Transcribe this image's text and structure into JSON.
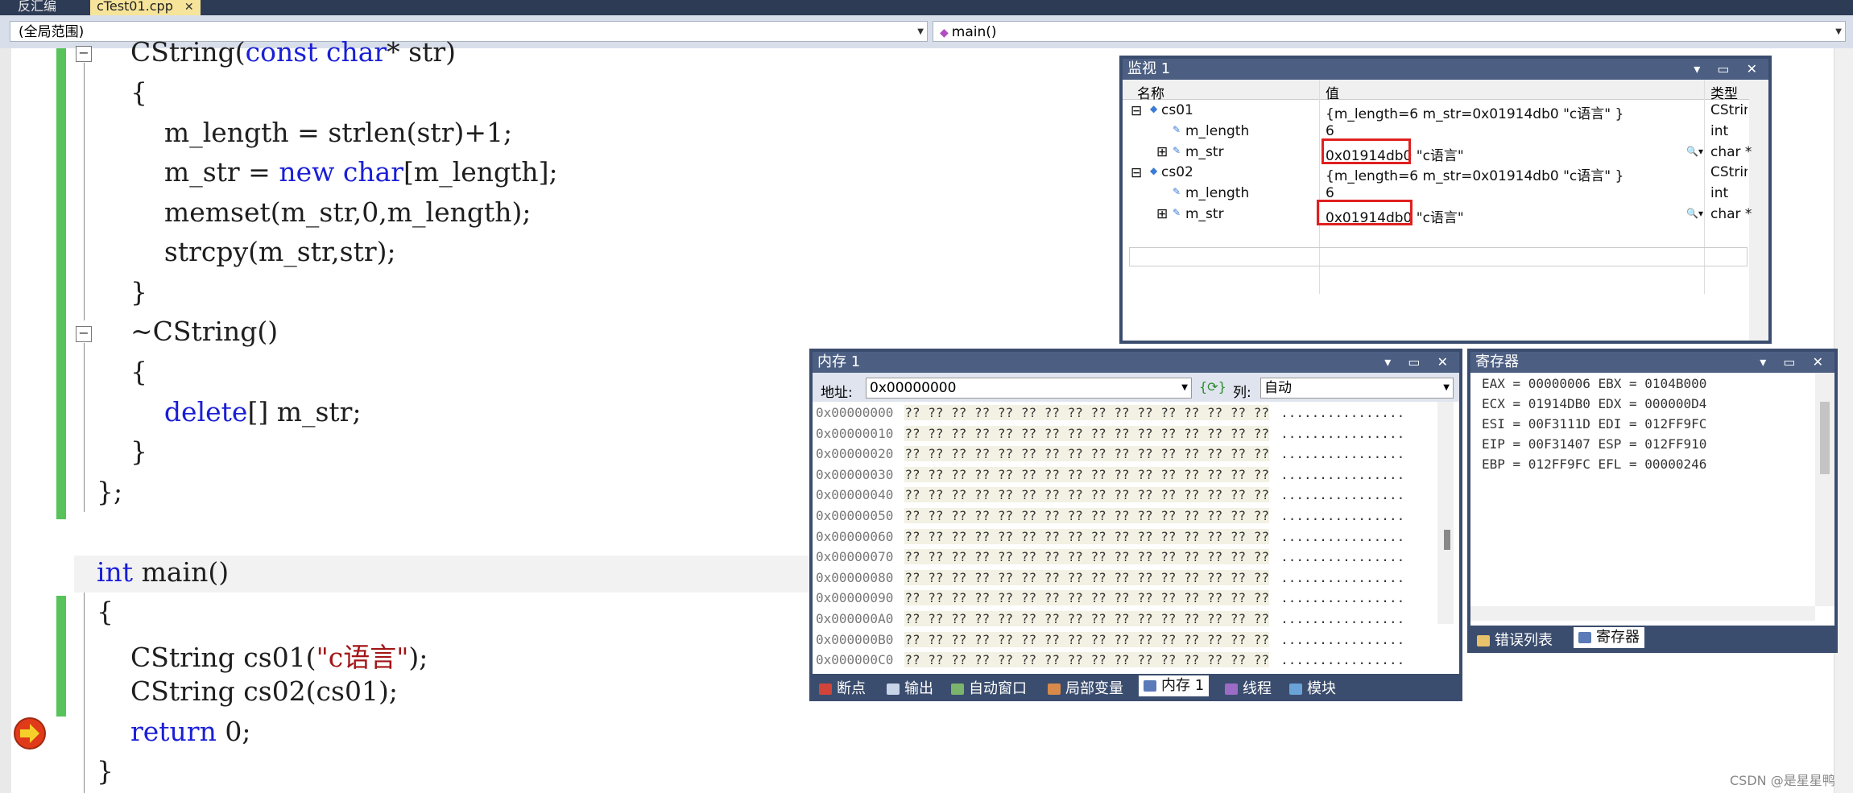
{
  "tabs": [
    {
      "label": "反汇编"
    },
    {
      "label": "cTest01.cpp",
      "close": "✕"
    }
  ],
  "nav": {
    "scope": "(全局范围)",
    "member": "main()"
  },
  "code": {
    "l1a": "    CString(",
    "l1b": "const",
    "l1c": " ",
    "l1d": "char",
    "l1e": "* str)",
    "l2": "    {",
    "l3": "        m_length = strlen(str)+1;",
    "l4a": "        m_str = ",
    "l4b": "new",
    "l4c": " ",
    "l4d": "char",
    "l4e": "[m_length];",
    "l5": "        memset(m_str,0,m_length);",
    "l6": "        strcpy(m_str,str);",
    "l7": "    }",
    "l8": "    ~CString()",
    "l9": "    {",
    "l10a": "        ",
    "l10b": "delete",
    "l10c": "[] m_str;",
    "l11": "    }",
    "l12": "};",
    "l13a": "int",
    "l13b": " main()",
    "l14": "{",
    "l15a": "    CString cs01(",
    "l15b": "\"c语言\"",
    "l15c": ");",
    "l16": "    CString cs02(cs01);",
    "l17a": "    ",
    "l17b": "return",
    "l17c": " 0;",
    "l18": "}"
  },
  "watch": {
    "title": "监视 1",
    "col_name": "名称",
    "col_value": "值",
    "col_type": "类型",
    "rows": [
      {
        "name": "cs01",
        "value": "{m_length=6 m_str=0x01914db0 \"c语言\" }",
        "type": "CStrin"
      },
      {
        "name": "m_length",
        "value": "6",
        "type": "int"
      },
      {
        "name": "m_str",
        "value_addr": "0x01914db0",
        "value_rest": " \"c语言\"",
        "type": "char *"
      },
      {
        "name": "cs02",
        "value": "{m_length=6 m_str=0x01914db0 \"c语言\" }",
        "type": "CStrin"
      },
      {
        "name": "m_length",
        "value": "6",
        "type": "int"
      },
      {
        "name": "m_str",
        "value_addr": "0x01914db0",
        "value_rest": " \"c语言\"",
        "type": "char *"
      }
    ]
  },
  "memory": {
    "title": "内存 1",
    "addr_label": "地址:",
    "addr_value": "0x00000000",
    "col_label": "列:",
    "col_value": "自动",
    "rows": [
      {
        "addr": "0x00000000",
        "bytes": "?? ?? ?? ?? ?? ?? ?? ?? ?? ?? ?? ?? ?? ?? ?? ??",
        "ascii": "................"
      },
      {
        "addr": "0x00000010",
        "bytes": "?? ?? ?? ?? ?? ?? ?? ?? ?? ?? ?? ?? ?? ?? ?? ??",
        "ascii": "................"
      },
      {
        "addr": "0x00000020",
        "bytes": "?? ?? ?? ?? ?? ?? ?? ?? ?? ?? ?? ?? ?? ?? ?? ??",
        "ascii": "................"
      },
      {
        "addr": "0x00000030",
        "bytes": "?? ?? ?? ?? ?? ?? ?? ?? ?? ?? ?? ?? ?? ?? ?? ??",
        "ascii": "................"
      },
      {
        "addr": "0x00000040",
        "bytes": "?? ?? ?? ?? ?? ?? ?? ?? ?? ?? ?? ?? ?? ?? ?? ??",
        "ascii": "................"
      },
      {
        "addr": "0x00000050",
        "bytes": "?? ?? ?? ?? ?? ?? ?? ?? ?? ?? ?? ?? ?? ?? ?? ??",
        "ascii": "................"
      },
      {
        "addr": "0x00000060",
        "bytes": "?? ?? ?? ?? ?? ?? ?? ?? ?? ?? ?? ?? ?? ?? ?? ??",
        "ascii": "................"
      },
      {
        "addr": "0x00000070",
        "bytes": "?? ?? ?? ?? ?? ?? ?? ?? ?? ?? ?? ?? ?? ?? ?? ??",
        "ascii": "................"
      },
      {
        "addr": "0x00000080",
        "bytes": "?? ?? ?? ?? ?? ?? ?? ?? ?? ?? ?? ?? ?? ?? ?? ??",
        "ascii": "................"
      },
      {
        "addr": "0x00000090",
        "bytes": "?? ?? ?? ?? ?? ?? ?? ?? ?? ?? ?? ?? ?? ?? ?? ??",
        "ascii": "................"
      },
      {
        "addr": "0x000000A0",
        "bytes": "?? ?? ?? ?? ?? ?? ?? ?? ?? ?? ?? ?? ?? ?? ?? ??",
        "ascii": "................"
      },
      {
        "addr": "0x000000B0",
        "bytes": "?? ?? ?? ?? ?? ?? ?? ?? ?? ?? ?? ?? ?? ?? ?? ??",
        "ascii": "................"
      },
      {
        "addr": "0x000000C0",
        "bytes": "?? ?? ?? ?? ?? ?? ?? ?? ?? ?? ?? ?? ?? ?? ?? ??",
        "ascii": "................"
      }
    ],
    "bottom_tabs": [
      "断点",
      "输出",
      "自动窗口",
      "局部变量",
      "内存 1",
      "线程",
      "模块"
    ]
  },
  "registers": {
    "title": "寄存器",
    "lines": [
      "EAX = 00000006 EBX = 0104B000",
      "ECX = 01914DB0 EDX = 000000D4",
      "ESI = 00F3111D EDI = 012FF9FC",
      "EIP = 00F31407 ESP = 012FF910",
      "EBP = 012FF9FC EFL = 00000246"
    ],
    "bottom_tabs": [
      "错误列表",
      "寄存器"
    ]
  },
  "watermark": "CSDN @是星星鸭"
}
